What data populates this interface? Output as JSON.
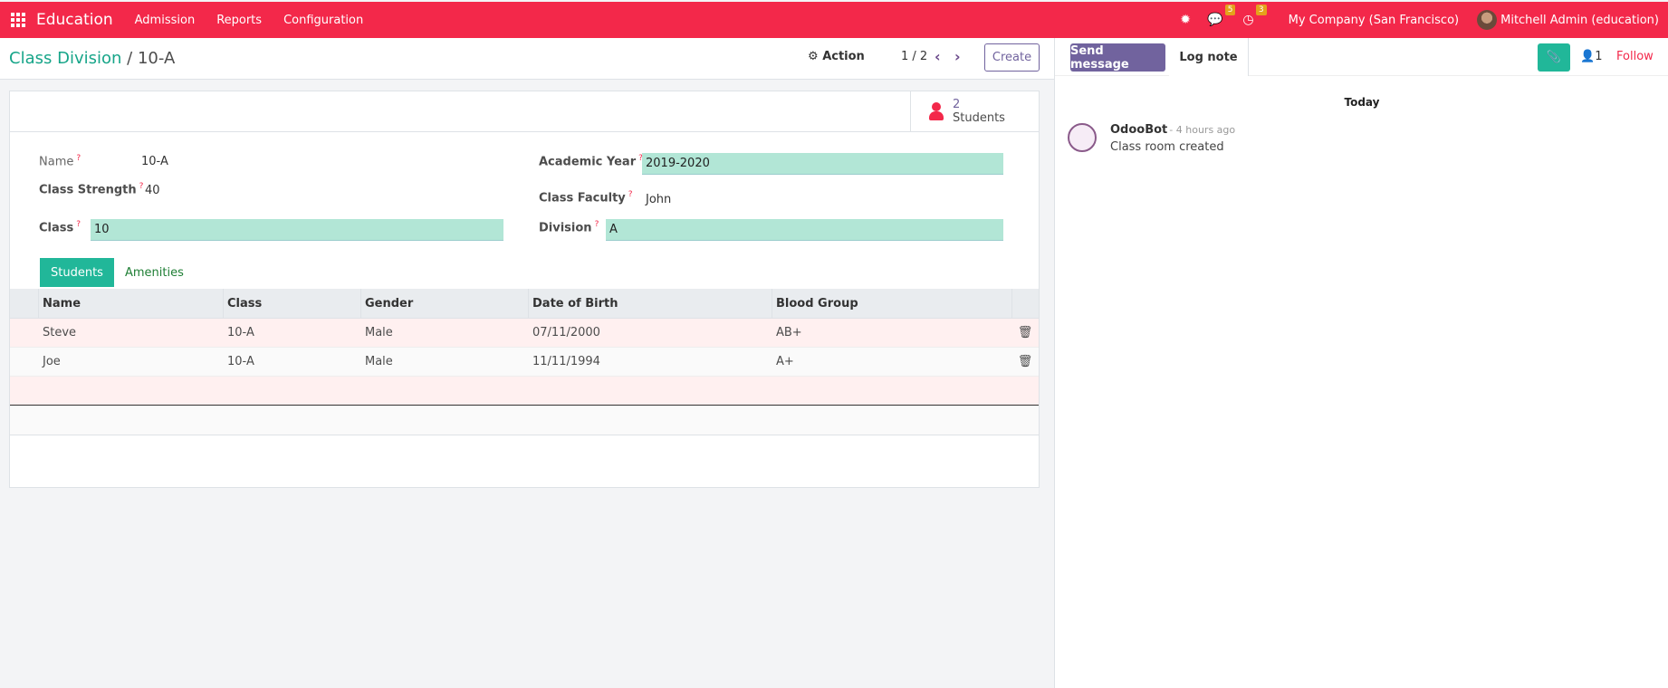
{
  "navbar": {
    "app_name": "Education",
    "menu": [
      "Admission",
      "Reports",
      "Configuration"
    ],
    "messages_count": "5",
    "activities_count": "3",
    "company": "My Company (San Francisco)",
    "user": "Mitchell Admin (education)"
  },
  "control_panel": {
    "breadcrumb_parent": "Class Division",
    "breadcrumb_sep": "/",
    "breadcrumb_current": "10-A",
    "action_label": "Action",
    "pager": "1 / 2",
    "create_label": "Create"
  },
  "smart_button": {
    "count": "2",
    "label": "Students"
  },
  "form": {
    "name_label": "Name",
    "name_value": "10-A",
    "strength_label": "Class Strength",
    "strength_value": "40",
    "class_label": "Class",
    "class_value": "10",
    "year_label": "Academic Year",
    "year_value": "2019-2020",
    "faculty_label": "Class Faculty",
    "faculty_value": "John",
    "division_label": "Division",
    "division_value": "A",
    "required_mark": "?"
  },
  "tabs": [
    "Students",
    "Amenities"
  ],
  "table": {
    "columns": [
      "Name",
      "Class",
      "Gender",
      "Date of Birth",
      "Blood Group"
    ],
    "rows": [
      [
        "Steve",
        "10-A",
        "Male",
        "07/11/2000",
        "AB+"
      ],
      [
        "Joe",
        "10-A",
        "Male",
        "11/11/1994",
        "A+"
      ]
    ]
  },
  "chatter": {
    "send_label": "Send message",
    "log_label": "Log note",
    "followers_count": "1",
    "follow_label": "Follow",
    "today_label": "Today",
    "author": "OdooBot",
    "time": "- 4 hours ago",
    "message": "Class room created"
  }
}
